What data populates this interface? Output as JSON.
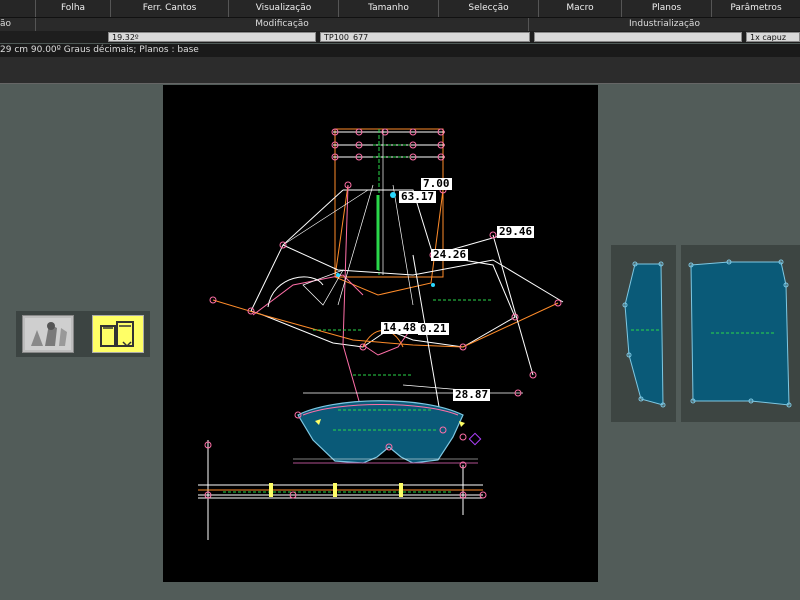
{
  "menubar": {
    "items": [
      "Folha",
      "Ferr. Cantos",
      "Visualização",
      "Tamanho",
      "Selecção",
      "Macro",
      "Planos",
      "Parâmetros"
    ]
  },
  "sections": {
    "left": "ão",
    "modification": "Modificação",
    "industrialization": "Industrialização"
  },
  "fields": {
    "angle": "19.32º",
    "piece_name": "TP100_677",
    "empty": "",
    "quantity": "1x capuz"
  },
  "status": {
    "text": "29 cm  90.00º  Graus décimais;    Planos :  base"
  },
  "canvas": {
    "labels": [
      "7.00",
      "63.17",
      "29.46",
      "24.26",
      "14.48",
      "0.21",
      "28.87"
    ]
  },
  "colors": {
    "workspace": "#525c59",
    "canvas_bg": "#000000",
    "piece_fill": "#0a5a78",
    "pattern_line": "#ffffff",
    "orange_line": "#ff8c2a",
    "green_line": "#2ad84a",
    "highlight": "#ffff66"
  },
  "icons": {
    "thumb1": "sketch-thumbnail-icon",
    "thumb2": "selected-thumbnail-icon"
  }
}
